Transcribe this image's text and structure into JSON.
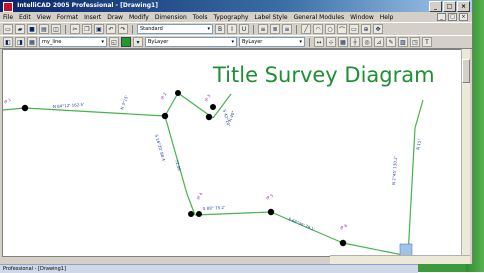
{
  "window": {
    "title": "IntelliCAD 2005 Professional - [Drawing1]",
    "buttons": [
      "_",
      "□",
      "×"
    ]
  },
  "menu": [
    "File",
    "Edit",
    "View",
    "Format",
    "Insert",
    "Draw",
    "Modify",
    "Dimension",
    "Tools",
    "Typography",
    "Label Style",
    "General Modules",
    "Window",
    "Help"
  ],
  "toolbar": {
    "font_combo": "Standard",
    "style_combo": "ByLayer",
    "layer_combo": "my_line",
    "linetype_combo": "ByLayer"
  },
  "drawing": {
    "title": "Title Survey Diagram"
  },
  "status": {
    "text": "Professional - [Drawing1]"
  },
  "colors": {
    "accent_green": "#1f8f33",
    "line_green": "#46b34b",
    "label_blue": "#1f3ea8",
    "label_purple": "#9a2fb2"
  }
}
